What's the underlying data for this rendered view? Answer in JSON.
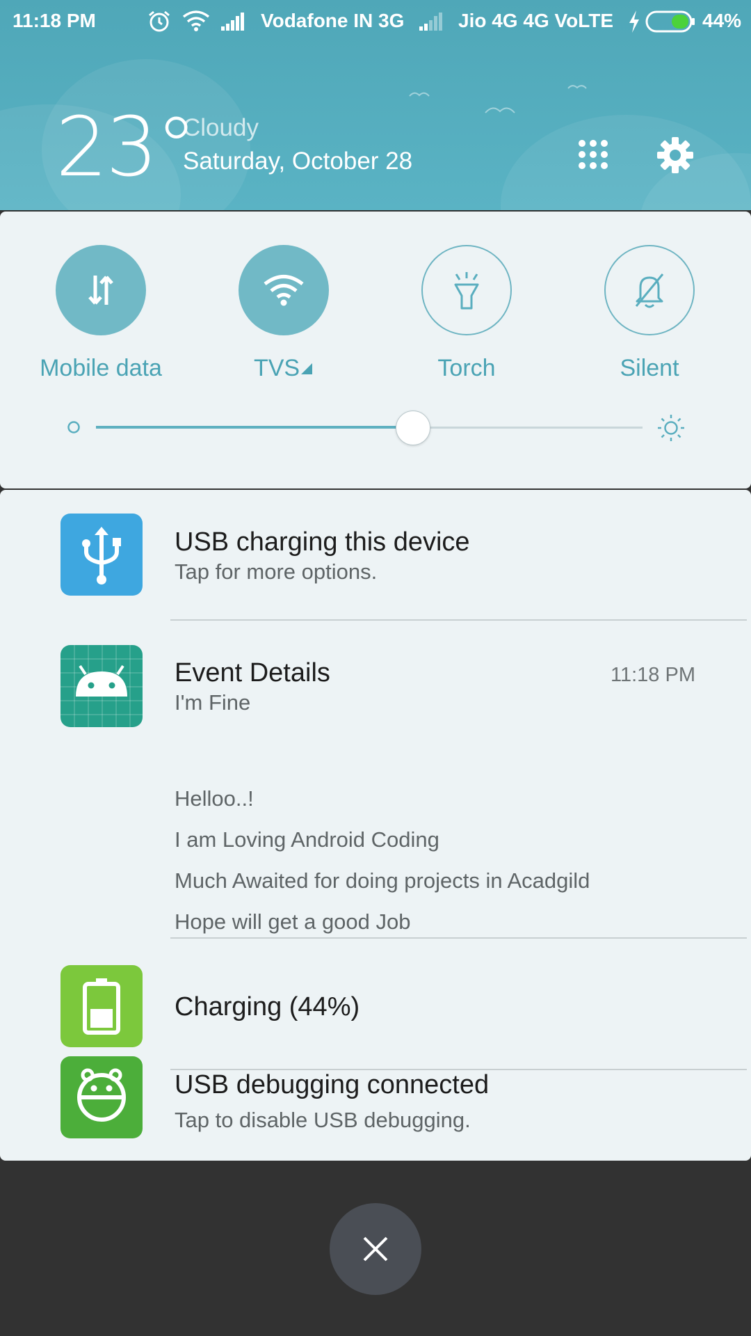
{
  "status_bar": {
    "time": "11:18 PM",
    "carrier1": "Vodafone IN 3G",
    "carrier2": "Jio 4G 4G VoLTE",
    "battery": "44%",
    "battery_level": 0.44
  },
  "header": {
    "temperature": "23°",
    "condition": "Cloudy",
    "date": "Saturday, October 28"
  },
  "quick_settings": {
    "toggles": [
      {
        "label": "Mobile data",
        "on": true
      },
      {
        "label": "TVS",
        "on": true
      },
      {
        "label": "Torch",
        "on": false
      },
      {
        "label": "Silent",
        "on": false
      }
    ],
    "brightness_level": 0.58
  },
  "notifications": [
    {
      "title": "USB charging this device",
      "subtitle": "Tap for more options.",
      "icon": "usb-icon",
      "color": "#3ea7e0"
    },
    {
      "title": "Event Details",
      "subtitle": "I'm Fine",
      "time": "11:18 PM",
      "icon": "android-icon",
      "color": "#26a08a",
      "lines": [
        "Helloo..!",
        "I am Loving Android Coding",
        "Much Awaited for doing projects in Acadgild",
        "Hope will get a good Job"
      ]
    },
    {
      "title": "Charging (44%)",
      "icon": "battery-charging-icon",
      "color": "#7cc83c"
    },
    {
      "title": "USB debugging connected",
      "subtitle": "Tap to disable USB debugging.",
      "icon": "android-debug-icon",
      "color": "#4cae3a"
    }
  ],
  "colors": {
    "header": "#55adbe",
    "accent": "#4aa3b4",
    "panel": "#edf3f5",
    "scrim": "#323232"
  }
}
